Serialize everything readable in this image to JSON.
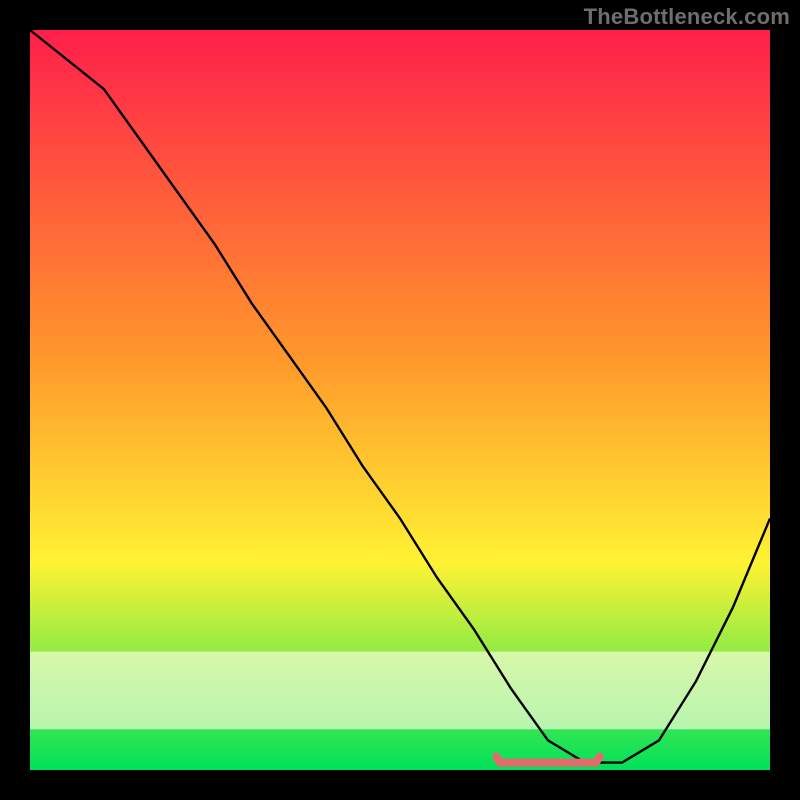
{
  "attribution": "TheBottleneck.com",
  "chart_data": {
    "type": "line",
    "title": "",
    "xlabel": "",
    "ylabel": "",
    "xlim": [
      0,
      100
    ],
    "ylim": [
      0,
      100
    ],
    "series": [
      {
        "name": "curve",
        "x": [
          0,
          5,
          10,
          15,
          20,
          25,
          30,
          35,
          40,
          45,
          50,
          55,
          60,
          65,
          70,
          75,
          78,
          80,
          85,
          90,
          95,
          100
        ],
        "y": [
          100,
          96,
          92,
          85,
          78,
          71,
          63,
          56,
          49,
          41,
          34,
          26,
          19,
          11,
          4,
          1,
          1,
          1,
          4,
          12,
          22,
          34
        ]
      }
    ],
    "flat_bottom_range_x": [
      63,
      77
    ],
    "highlight_band_y": [
      0,
      4
    ],
    "colors": {
      "gradient_top": "#ff1f4b",
      "gradient_mid": "#fff233",
      "gradient_bottom": "#00e25a",
      "band": "#fffde0",
      "curve": "#000000",
      "flat_marker": "#e46b6b",
      "frame": "#000000"
    }
  },
  "layout": {
    "outer_w": 800,
    "outer_h": 800,
    "inner_x": 30,
    "inner_y": 30,
    "inner_w": 740,
    "inner_h": 740
  }
}
